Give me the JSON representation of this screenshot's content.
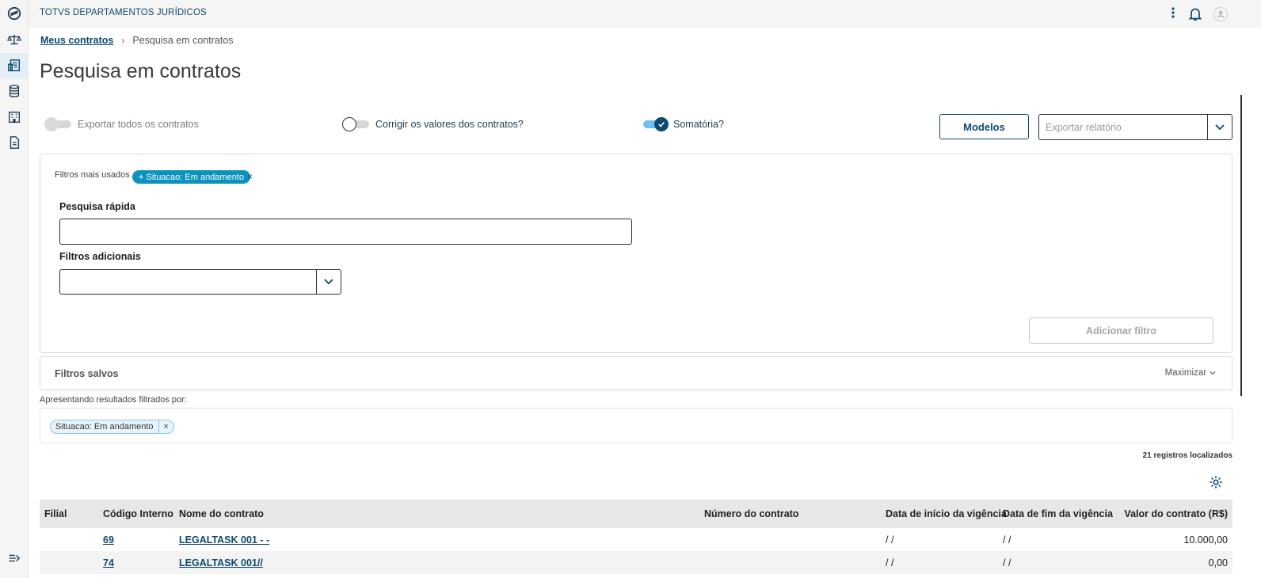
{
  "app": {
    "title": "TOTVS DEPARTAMENTOS JURÍDICOS"
  },
  "rail": {
    "items": [
      {
        "icon": "totvs-logo-icon"
      },
      {
        "icon": "scale-icon"
      },
      {
        "icon": "contracts-icon"
      },
      {
        "icon": "database-icon"
      },
      {
        "icon": "building-icon"
      },
      {
        "icon": "document-icon"
      }
    ],
    "collapse_icon": "expand-menu-icon"
  },
  "breadcrumb": {
    "parent": "Meus contratos",
    "current": "Pesquisa em contratos"
  },
  "page": {
    "title": "Pesquisa em contratos"
  },
  "switches": {
    "export_all": {
      "label": "Exportar todos os contratos",
      "state": "disabled"
    },
    "correct_values": {
      "label": "Corrigir os valores dos contratos?",
      "state": "off"
    },
    "sum": {
      "label": "Somatória?",
      "state": "on"
    }
  },
  "toolbar": {
    "models_label": "Modelos",
    "export_placeholder": "Exportar relatório"
  },
  "filters": {
    "most_used_label": "Filtros mais usados",
    "most_used_chip": "+ Situacao: Em andamento",
    "chip_remove": "×",
    "quick_search_label": "Pesquisa rápida",
    "quick_search_value": "",
    "additional_label": "Filtros adicionais",
    "add_filter_label": "Adicionar filtro"
  },
  "saved_filters": {
    "title": "Filtros salvos",
    "maximize_label": "Maximizar"
  },
  "results": {
    "label": "Apresentando resultados filtrados por:",
    "applied_chip": "Situacao: Em andamento",
    "applied_chip_remove": "×",
    "count_text": "21 registros localizados"
  },
  "table": {
    "columns": [
      "Filial",
      "Código Interno",
      "Nome do contrato",
      "Número do contrato",
      "Data de início da vigência",
      "Data de fim da vigência",
      "Valor do contrato (R$)"
    ],
    "rows": [
      {
        "filial": "",
        "codigo": "69",
        "nome": "LEGALTASK 001 - -",
        "numero": "",
        "inicio": "/ /",
        "fim": "/ /",
        "valor": "10.000,00"
      },
      {
        "filial": "",
        "codigo": "74",
        "nome": "LEGALTASK 001//",
        "numero": "",
        "inicio": "/ /",
        "fim": "/ /",
        "valor": "0,00"
      }
    ]
  },
  "colors": {
    "primary": "#0c4a70",
    "accent": "#0b93bd",
    "switch_on": "#6ec1ef"
  }
}
